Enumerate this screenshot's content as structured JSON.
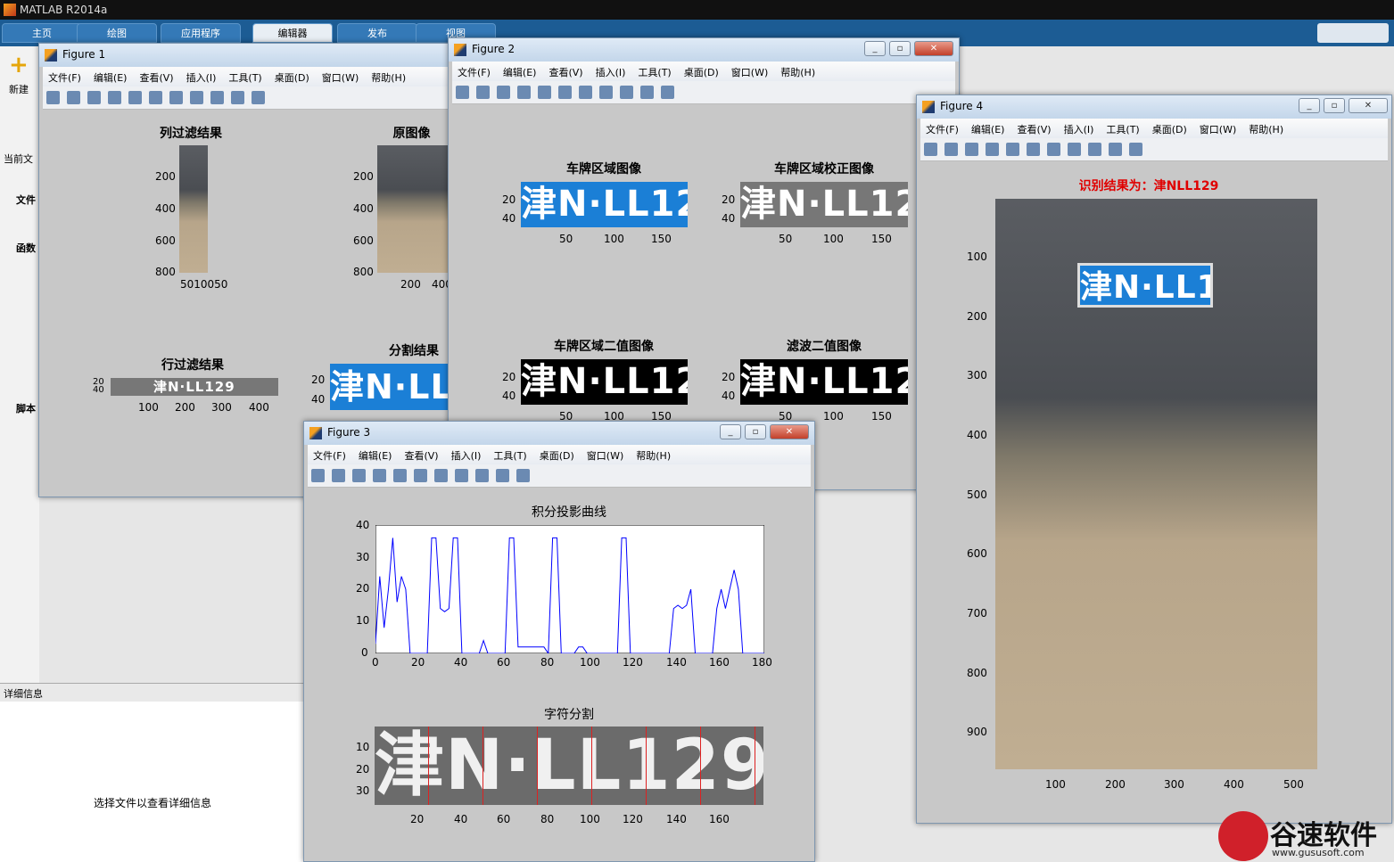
{
  "app": {
    "title": "MATLAB R2014a"
  },
  "ribbon": {
    "tabs": [
      "主页",
      "绘图",
      "应用程序",
      "编辑器",
      "发布",
      "视图"
    ],
    "selected": "编辑器"
  },
  "left": {
    "new_label": "新建",
    "current_folder": "当前文",
    "tree_files": "文件",
    "tree_funcs": "函数",
    "tree_scripts": "脚本"
  },
  "detail": {
    "header": "详细信息",
    "message": "选择文件以查看详细信息"
  },
  "menus": [
    "文件(F)",
    "编辑(E)",
    "查看(V)",
    "插入(I)",
    "工具(T)",
    "桌面(D)",
    "窗口(W)",
    "帮助(H)"
  ],
  "figure1": {
    "title": "Figure 1",
    "col_filter": "列过滤结果",
    "original": "原图像",
    "row_filter": "行过滤结果",
    "segment": "分割结果",
    "ticks_y": [
      "200",
      "400",
      "600",
      "800"
    ],
    "ticks_x_col": "5010050",
    "ticks_x_orig": [
      "200",
      "400"
    ],
    "ticks_row_x": [
      "100",
      "200",
      "300",
      "400"
    ],
    "ticks_row_y": [
      "20",
      "40"
    ],
    "ticks_seg_y": [
      "20",
      "40"
    ]
  },
  "figure2": {
    "title": "Figure 2",
    "p1": "车牌区域图像",
    "p2": "车牌区域校正图像",
    "p3": "车牌区域二值图像",
    "p4": "滤波二值图像",
    "yt": [
      "20",
      "40"
    ],
    "xt": [
      "50",
      "100",
      "150"
    ]
  },
  "figure3": {
    "title": "Figure 3",
    "p1": "积分投影曲线",
    "p2": "字符分割",
    "y1": [
      "40",
      "30",
      "20",
      "10",
      "0"
    ],
    "x1": [
      "0",
      "20",
      "40",
      "60",
      "80",
      "100",
      "120",
      "140",
      "160",
      "180"
    ],
    "y2": [
      "10",
      "20",
      "30"
    ],
    "x2": [
      "20",
      "40",
      "60",
      "80",
      "100",
      "120",
      "140",
      "160"
    ]
  },
  "figure4": {
    "title": "Figure 4",
    "result": "识别结果为：津NLL129",
    "yt": [
      "100",
      "200",
      "300",
      "400",
      "500",
      "600",
      "700",
      "800",
      "900"
    ],
    "xt": [
      "100",
      "200",
      "300",
      "400",
      "500"
    ]
  },
  "plate_text": "津N·LL129",
  "watermark": {
    "brand": "谷速软件",
    "url": "www.gususoft.com"
  },
  "chart_data": {
    "type": "line",
    "title": "积分投影曲线",
    "xlim": [
      0,
      180
    ],
    "ylim": [
      0,
      40
    ],
    "x": [
      0,
      2,
      4,
      6,
      8,
      10,
      12,
      14,
      16,
      18,
      20,
      22,
      24,
      26,
      28,
      30,
      32,
      34,
      36,
      38,
      40,
      42,
      44,
      46,
      48,
      50,
      52,
      54,
      56,
      58,
      60,
      62,
      64,
      66,
      68,
      70,
      72,
      74,
      76,
      78,
      80,
      82,
      84,
      86,
      88,
      90,
      92,
      94,
      96,
      98,
      100,
      102,
      104,
      106,
      108,
      110,
      112,
      114,
      116,
      118,
      120,
      122,
      124,
      126,
      128,
      130,
      132,
      134,
      136,
      138,
      140,
      142,
      144,
      146,
      148,
      150,
      152,
      154,
      156,
      158,
      160,
      162,
      164,
      166,
      168,
      170,
      172,
      174,
      176,
      178,
      180
    ],
    "y": [
      3,
      24,
      8,
      20,
      36,
      16,
      24,
      20,
      0,
      0,
      0,
      0,
      0,
      36,
      36,
      14,
      13,
      14,
      36,
      36,
      0,
      0,
      0,
      0,
      0,
      4,
      0,
      0,
      0,
      0,
      0,
      36,
      36,
      2,
      2,
      2,
      2,
      2,
      2,
      2,
      0,
      36,
      36,
      0,
      0,
      0,
      0,
      2,
      2,
      0,
      0,
      0,
      0,
      0,
      0,
      0,
      0,
      36,
      36,
      0,
      0,
      0,
      0,
      0,
      0,
      0,
      0,
      0,
      0,
      14,
      15,
      14,
      15,
      20,
      0,
      0,
      0,
      0,
      0,
      14,
      20,
      14,
      20,
      26,
      20,
      0,
      0,
      0,
      0,
      0,
      0
    ]
  }
}
